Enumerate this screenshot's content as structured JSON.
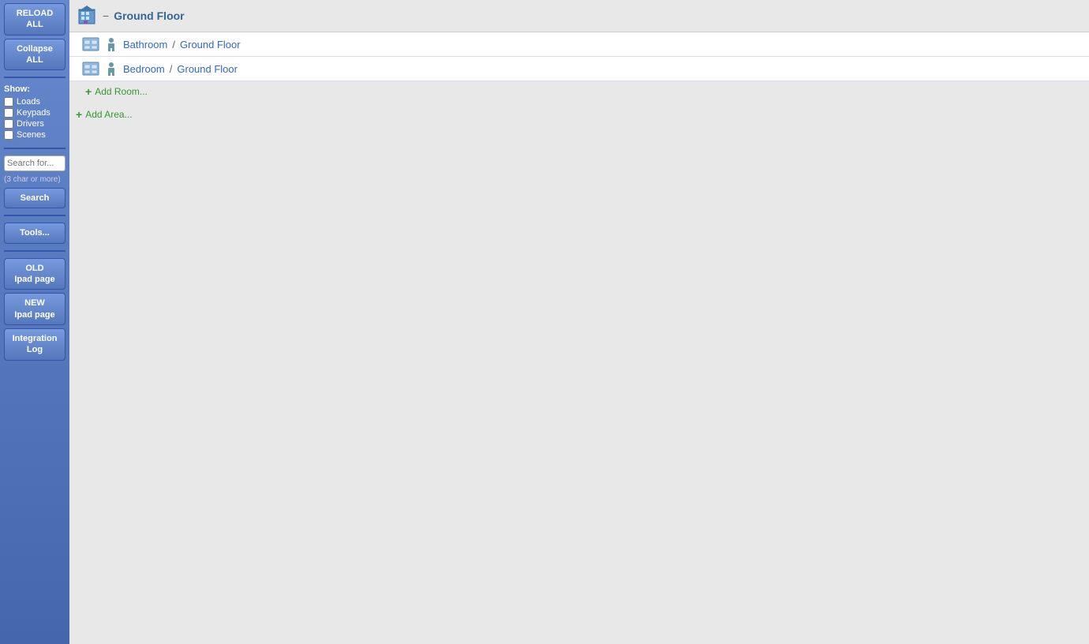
{
  "sidebar": {
    "reload_label": "RELOAD\nALL",
    "collapse_label": "Collapse\nALL",
    "show_title": "Show:",
    "checkboxes": [
      {
        "label": "Loads",
        "checked": false
      },
      {
        "label": "Keypads",
        "checked": false
      },
      {
        "label": "Drivers",
        "checked": false
      },
      {
        "label": "Scenes",
        "checked": false
      }
    ],
    "search_placeholder": "Search for...",
    "search_hint": "(3 char or more)",
    "search_label": "Search",
    "tools_label": "Tools...",
    "old_ipad_label": "OLD\nIpad page",
    "new_ipad_label": "NEW\nIpad page",
    "integration_label": "Integration\nLog"
  },
  "main": {
    "floor_name": "Ground Floor",
    "rooms": [
      {
        "name": "Bathroom",
        "floor": "Ground Floor",
        "separator": "/"
      },
      {
        "name": "Bedroom",
        "floor": "Ground Floor",
        "separator": "/"
      }
    ],
    "add_room_label": "Add Room...",
    "add_area_label": "Add Area..."
  }
}
